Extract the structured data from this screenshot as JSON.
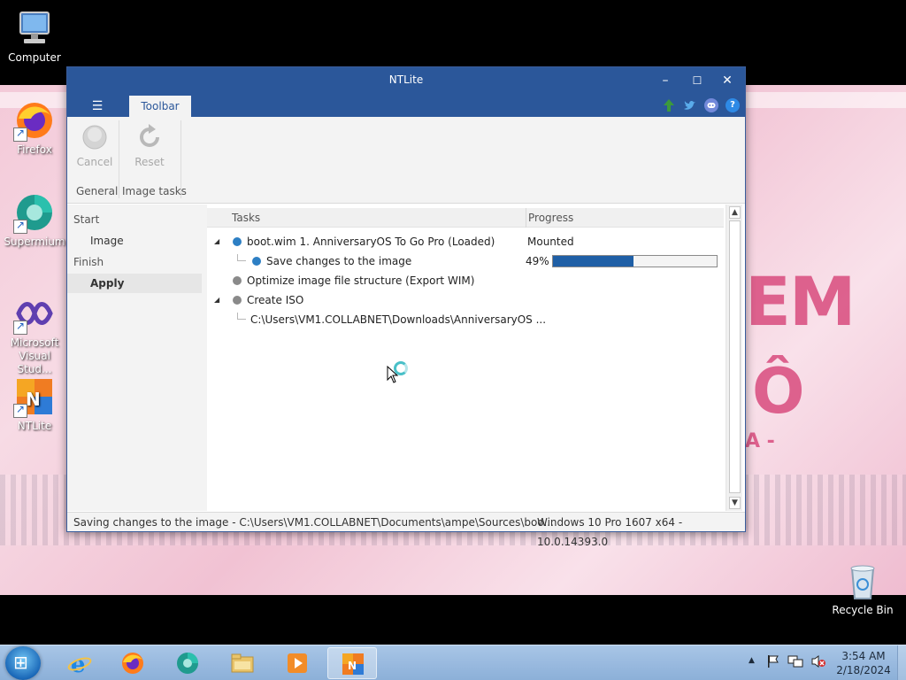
{
  "desktop": {
    "icons": [
      {
        "name": "Computer"
      },
      {
        "name": "Firefox"
      },
      {
        "name": "Supermium"
      },
      {
        "name": "Microsoft Visual Stud..."
      },
      {
        "name": "NTLite"
      },
      {
        "name": "Recycle Bin"
      }
    ],
    "wallpaper": {
      "text_main": "EM",
      "text_o": "Ô",
      "text_dash": "A -"
    }
  },
  "window": {
    "title": "NTLite",
    "controls": {
      "minimize": "–",
      "maximize": "☐",
      "close": "✕"
    },
    "menu_icon": "☰",
    "tab": "Toolbar",
    "top_icons": [
      "update-arrow-icon",
      "twitter-icon",
      "discord-icon",
      "help-icon"
    ],
    "help_glyph": "?",
    "ribbon": {
      "cancel_label": "Cancel",
      "reset_label": "Reset",
      "group_general": "General",
      "group_image_tasks": "Image tasks"
    },
    "sidenav": {
      "start": "Start",
      "image": "Image",
      "finish": "Finish",
      "apply": "Apply"
    },
    "tasks": {
      "col_tasks": "Tasks",
      "col_progress": "Progress",
      "rows": [
        {
          "text": "boot.wim 1. AnniversaryOS To Go Pro  (Loaded)",
          "progress": "Mounted"
        },
        {
          "text": "Save changes to the image",
          "progress": "49%"
        },
        {
          "text": "Optimize image file structure (Export WIM)",
          "progress": ""
        },
        {
          "text": "Create ISO",
          "progress": ""
        },
        {
          "text": "C:\\Users\\VM1.COLLABNET\\Downloads\\AnniversaryOS ...",
          "progress": ""
        }
      ],
      "save_progress_percent": 49
    },
    "status": {
      "left": "Saving changes to the image - C:\\Users\\VM1.COLLABNET\\Documents\\ampe\\Sources\\boo...",
      "right": "Windows 10 Pro 1607 x64 - 10.0.14393.0"
    }
  },
  "taskbar": {
    "time": "3:54 AM",
    "date": "2/18/2024",
    "tray_chevron": "▲"
  },
  "colors": {
    "accent": "#2b579a",
    "progress_fill": "#1f5fa6"
  }
}
